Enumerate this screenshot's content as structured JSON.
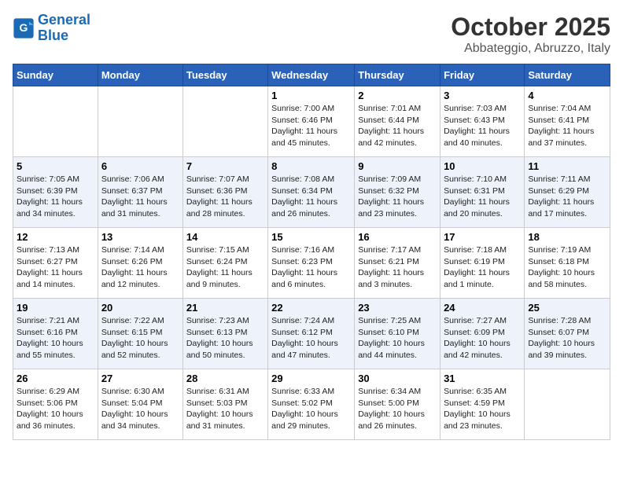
{
  "header": {
    "logo_general": "General",
    "logo_blue": "Blue",
    "month": "October 2025",
    "location": "Abbateggio, Abruzzo, Italy"
  },
  "weekdays": [
    "Sunday",
    "Monday",
    "Tuesday",
    "Wednesday",
    "Thursday",
    "Friday",
    "Saturday"
  ],
  "weeks": [
    [
      {
        "day": "",
        "info": ""
      },
      {
        "day": "",
        "info": ""
      },
      {
        "day": "",
        "info": ""
      },
      {
        "day": "1",
        "info": "Sunrise: 7:00 AM\nSunset: 6:46 PM\nDaylight: 11 hours\nand 45 minutes."
      },
      {
        "day": "2",
        "info": "Sunrise: 7:01 AM\nSunset: 6:44 PM\nDaylight: 11 hours\nand 42 minutes."
      },
      {
        "day": "3",
        "info": "Sunrise: 7:03 AM\nSunset: 6:43 PM\nDaylight: 11 hours\nand 40 minutes."
      },
      {
        "day": "4",
        "info": "Sunrise: 7:04 AM\nSunset: 6:41 PM\nDaylight: 11 hours\nand 37 minutes."
      }
    ],
    [
      {
        "day": "5",
        "info": "Sunrise: 7:05 AM\nSunset: 6:39 PM\nDaylight: 11 hours\nand 34 minutes."
      },
      {
        "day": "6",
        "info": "Sunrise: 7:06 AM\nSunset: 6:37 PM\nDaylight: 11 hours\nand 31 minutes."
      },
      {
        "day": "7",
        "info": "Sunrise: 7:07 AM\nSunset: 6:36 PM\nDaylight: 11 hours\nand 28 minutes."
      },
      {
        "day": "8",
        "info": "Sunrise: 7:08 AM\nSunset: 6:34 PM\nDaylight: 11 hours\nand 26 minutes."
      },
      {
        "day": "9",
        "info": "Sunrise: 7:09 AM\nSunset: 6:32 PM\nDaylight: 11 hours\nand 23 minutes."
      },
      {
        "day": "10",
        "info": "Sunrise: 7:10 AM\nSunset: 6:31 PM\nDaylight: 11 hours\nand 20 minutes."
      },
      {
        "day": "11",
        "info": "Sunrise: 7:11 AM\nSunset: 6:29 PM\nDaylight: 11 hours\nand 17 minutes."
      }
    ],
    [
      {
        "day": "12",
        "info": "Sunrise: 7:13 AM\nSunset: 6:27 PM\nDaylight: 11 hours\nand 14 minutes."
      },
      {
        "day": "13",
        "info": "Sunrise: 7:14 AM\nSunset: 6:26 PM\nDaylight: 11 hours\nand 12 minutes."
      },
      {
        "day": "14",
        "info": "Sunrise: 7:15 AM\nSunset: 6:24 PM\nDaylight: 11 hours\nand 9 minutes."
      },
      {
        "day": "15",
        "info": "Sunrise: 7:16 AM\nSunset: 6:23 PM\nDaylight: 11 hours\nand 6 minutes."
      },
      {
        "day": "16",
        "info": "Sunrise: 7:17 AM\nSunset: 6:21 PM\nDaylight: 11 hours\nand 3 minutes."
      },
      {
        "day": "17",
        "info": "Sunrise: 7:18 AM\nSunset: 6:19 PM\nDaylight: 11 hours\nand 1 minute."
      },
      {
        "day": "18",
        "info": "Sunrise: 7:19 AM\nSunset: 6:18 PM\nDaylight: 10 hours\nand 58 minutes."
      }
    ],
    [
      {
        "day": "19",
        "info": "Sunrise: 7:21 AM\nSunset: 6:16 PM\nDaylight: 10 hours\nand 55 minutes."
      },
      {
        "day": "20",
        "info": "Sunrise: 7:22 AM\nSunset: 6:15 PM\nDaylight: 10 hours\nand 52 minutes."
      },
      {
        "day": "21",
        "info": "Sunrise: 7:23 AM\nSunset: 6:13 PM\nDaylight: 10 hours\nand 50 minutes."
      },
      {
        "day": "22",
        "info": "Sunrise: 7:24 AM\nSunset: 6:12 PM\nDaylight: 10 hours\nand 47 minutes."
      },
      {
        "day": "23",
        "info": "Sunrise: 7:25 AM\nSunset: 6:10 PM\nDaylight: 10 hours\nand 44 minutes."
      },
      {
        "day": "24",
        "info": "Sunrise: 7:27 AM\nSunset: 6:09 PM\nDaylight: 10 hours\nand 42 minutes."
      },
      {
        "day": "25",
        "info": "Sunrise: 7:28 AM\nSunset: 6:07 PM\nDaylight: 10 hours\nand 39 minutes."
      }
    ],
    [
      {
        "day": "26",
        "info": "Sunrise: 6:29 AM\nSunset: 5:06 PM\nDaylight: 10 hours\nand 36 minutes."
      },
      {
        "day": "27",
        "info": "Sunrise: 6:30 AM\nSunset: 5:04 PM\nDaylight: 10 hours\nand 34 minutes."
      },
      {
        "day": "28",
        "info": "Sunrise: 6:31 AM\nSunset: 5:03 PM\nDaylight: 10 hours\nand 31 minutes."
      },
      {
        "day": "29",
        "info": "Sunrise: 6:33 AM\nSunset: 5:02 PM\nDaylight: 10 hours\nand 29 minutes."
      },
      {
        "day": "30",
        "info": "Sunrise: 6:34 AM\nSunset: 5:00 PM\nDaylight: 10 hours\nand 26 minutes."
      },
      {
        "day": "31",
        "info": "Sunrise: 6:35 AM\nSunset: 4:59 PM\nDaylight: 10 hours\nand 23 minutes."
      },
      {
        "day": "",
        "info": ""
      }
    ]
  ]
}
